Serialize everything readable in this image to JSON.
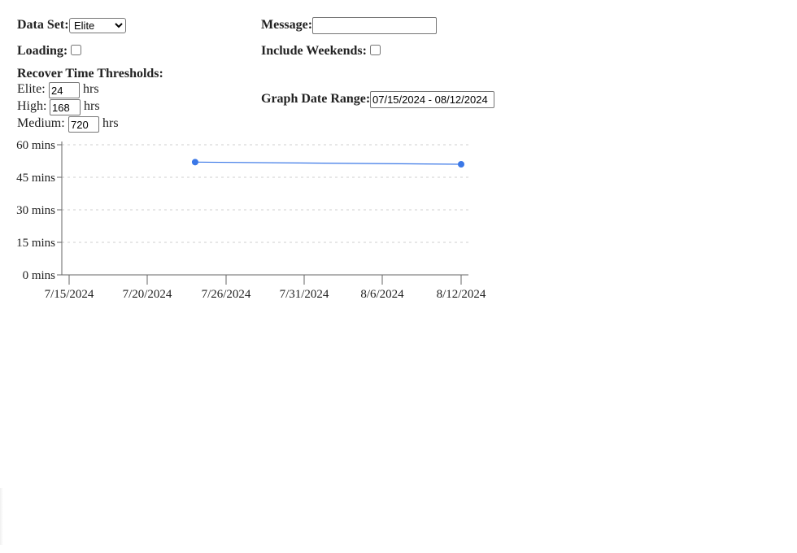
{
  "controls": {
    "dataset": {
      "label": "Data Set:",
      "selected": "Elite"
    },
    "message": {
      "label": "Message:",
      "value": ""
    },
    "loading": {
      "label": "Loading:",
      "checked": false
    },
    "include_weekends": {
      "label": "Include Weekends:",
      "checked": false
    },
    "thresholds": {
      "heading": "Recover Time Thresholds:",
      "unit": "hrs",
      "elite": {
        "label": "Elite:",
        "value": "24"
      },
      "high": {
        "label": "High:",
        "value": "168"
      },
      "medium": {
        "label": "Medium:",
        "value": "720"
      }
    },
    "date_range": {
      "label": "Graph Date Range:",
      "value": "07/15/2024 - 08/12/2024"
    }
  },
  "chart_data": {
    "type": "line",
    "x": [
      "2024-07-24",
      "2024-08-12"
    ],
    "series": [
      {
        "values": [
          52,
          51
        ],
        "color": "#3b78e7"
      }
    ],
    "x_ticks": [
      "7/15/2024",
      "7/20/2024",
      "7/26/2024",
      "7/31/2024",
      "8/6/2024",
      "8/12/2024"
    ],
    "y_ticks": [
      "0 mins",
      "15 mins",
      "30 mins",
      "45 mins",
      "60 mins"
    ],
    "ylim": [
      0,
      60
    ],
    "grid": true
  }
}
